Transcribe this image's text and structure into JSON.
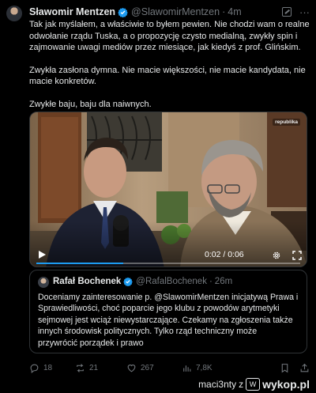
{
  "tweet": {
    "author_name": "Sławomir Mentzen",
    "handle": "@SlawomirMentzen",
    "separator": "·",
    "time": "4m",
    "paragraphs": [
      "Tak jak myślałem, a właściwie to byłem pewien. Nie chodzi wam o realne odwołanie rządu Tuska, a o propozycję czysto medialną, zwykły spin i zajmowanie uwagi mediów przez miesiące, jak kiedyś z prof. Glińskim.",
      "Zwykła zasłona dymna. Nie macie większości, nie macie kandydata, nie macie konkretów.",
      "Zwykłe baju, baju dla naiwnych."
    ]
  },
  "video": {
    "time_display": "0:02 / 0:06",
    "progress": 0.33,
    "channel_tag": "republika"
  },
  "quote": {
    "author_name": "Rafał Bochenek",
    "handle": "@RafalBochenek",
    "separator": "·",
    "time": "26m",
    "text": "Doceniamy zainteresowanie p. @SlawomirMentzen inicjatywą Prawa i Sprawiedliwości, choć poparcie jego klubu z powodów arytmetyki sejmowej jest wciąż niewystarczające. Czekamy na zgłoszenia także innych środowisk politycznych. Tylko rząd techniczny może przywrócić porządek i prawo"
  },
  "actions": {
    "replies": "18",
    "reposts": "21",
    "likes": "267",
    "views": "7,8K"
  },
  "watermark": {
    "user": "maci3nty",
    "connector": "z",
    "brand": "wykop.pl"
  },
  "colors": {
    "background": "#000000",
    "text": "#e7e9ea",
    "muted": "#71767b",
    "verified": "#1d9bf0",
    "border": "#2f3336"
  }
}
